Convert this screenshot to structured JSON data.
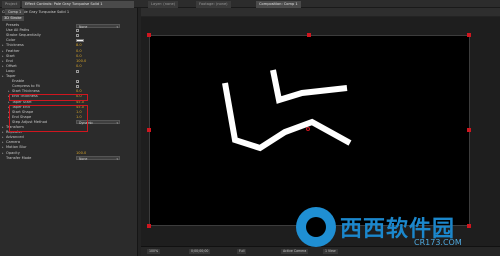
{
  "tabs": [
    {
      "label": "Project"
    },
    {
      "label": "Effect Controls: Pale Gray Turquoise Solid 1"
    },
    {
      "label": "Layer: (none)"
    },
    {
      "label": "Footage: (none)"
    },
    {
      "label": "Composition: Comp 1"
    }
  ],
  "effect_controls": {
    "header": "Comp 1 • Pale Gray Turquoise Solid 1",
    "effect_name": "3D Stroke",
    "rows": [
      {
        "label": "Presets",
        "value": "None",
        "kind": "dropdown"
      },
      {
        "label": "Use All Paths",
        "value": "",
        "kind": "checkbox"
      },
      {
        "label": "Stroke Sequentially",
        "value": "",
        "kind": "checkbox"
      },
      {
        "label": "Color",
        "value": "",
        "kind": "swatch"
      },
      {
        "label": "Thickness",
        "value": "8.0",
        "kind": "value"
      },
      {
        "label": "Feather",
        "value": "0.0",
        "kind": "value"
      },
      {
        "label": "Start",
        "value": "0.0",
        "kind": "value"
      },
      {
        "label": "End",
        "value": "100.0",
        "kind": "value"
      },
      {
        "label": "Offset",
        "value": "0.0",
        "kind": "value"
      },
      {
        "label": "Loop",
        "value": "",
        "kind": "checkbox"
      },
      {
        "label": "Taper",
        "value": "",
        "kind": "group"
      },
      {
        "label": "Enable",
        "value": "✓",
        "kind": "checkbox"
      },
      {
        "label": "Compress to Fit",
        "value": "",
        "kind": "checkbox"
      },
      {
        "label": "Start Thickness",
        "value": "0.0",
        "kind": "value"
      },
      {
        "label": "End Thickness",
        "value": "0.0",
        "kind": "value"
      },
      {
        "label": "Taper Start",
        "value": "45.0",
        "kind": "value"
      },
      {
        "label": "Taper End",
        "value": "45.0",
        "kind": "value"
      },
      {
        "label": "Start Shape",
        "value": "1.0",
        "kind": "value"
      },
      {
        "label": "End Shape",
        "value": "1.0",
        "kind": "value"
      },
      {
        "label": "Step Adjust Method",
        "value": "Dynamic",
        "kind": "dropdown"
      },
      {
        "label": "Transform",
        "value": "",
        "kind": "group"
      },
      {
        "label": "Repeater",
        "value": "",
        "kind": "group"
      },
      {
        "label": "Advanced",
        "value": "",
        "kind": "group"
      },
      {
        "label": "Camera",
        "value": "",
        "kind": "group"
      },
      {
        "label": "Motion Blur",
        "value": "",
        "kind": "group"
      },
      {
        "label": "Opacity",
        "value": "100.0",
        "kind": "value"
      },
      {
        "label": "Transfer Mode",
        "value": "None",
        "kind": "dropdown"
      }
    ]
  },
  "composition": {
    "tab": "Comp 1"
  },
  "bottom_bar": {
    "zoom": "100%",
    "timecode": "0;00;00;00",
    "resolution": "Full",
    "camera": "Active Camera",
    "views": "1 View"
  },
  "watermark": {
    "brand": "西西软件园",
    "url": "CR173.COM"
  }
}
